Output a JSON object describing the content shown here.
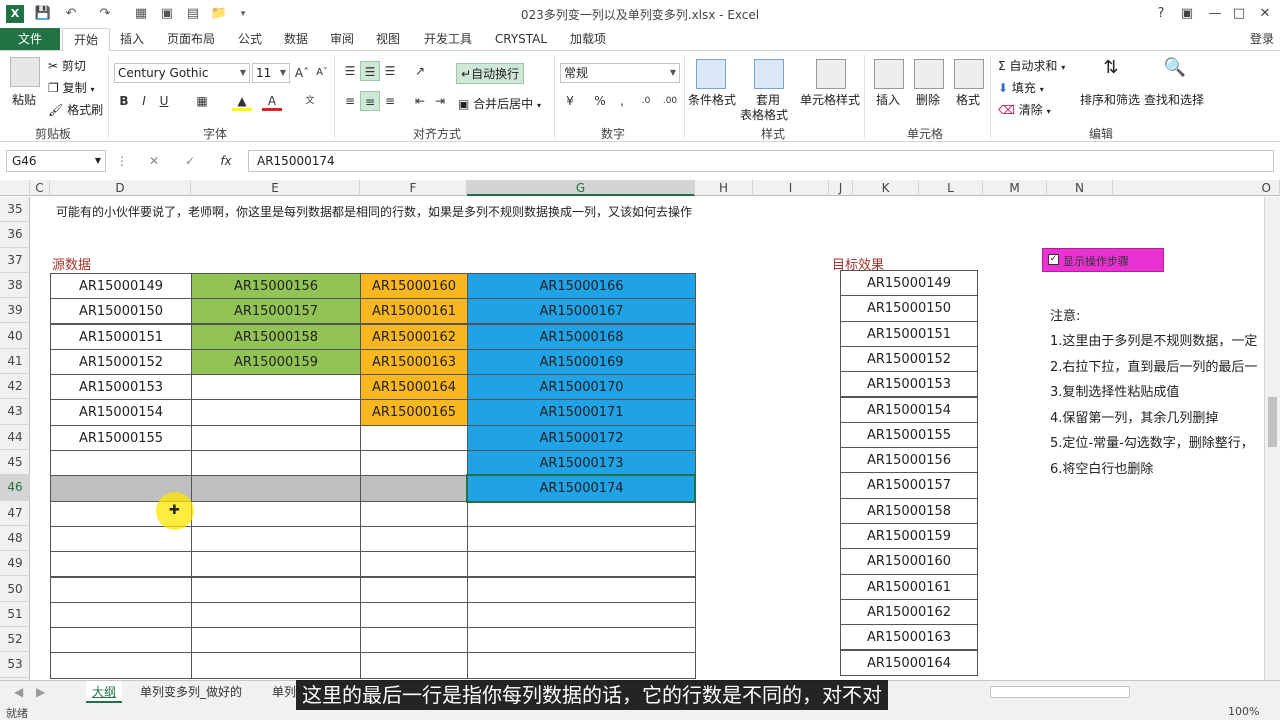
{
  "window": {
    "title": "023多列变一列以及单列变多列.xlsx - Excel",
    "help": "?",
    "signin": "登录"
  },
  "tabs": [
    "文件",
    "开始",
    "插入",
    "页面布局",
    "公式",
    "数据",
    "审阅",
    "视图",
    "开发工具",
    "CRYSTAL",
    "加载项"
  ],
  "ribbon": {
    "paste": "粘贴",
    "cut": "剪切",
    "copy": "复制",
    "format_painter": "格式刷",
    "clipboard_group": "剪贴板",
    "font_name": "Century Gothic",
    "font_size": "11",
    "font_group": "字体",
    "wrap_text": "自动换行",
    "merge_center": "合并后居中",
    "alignment_group": "对齐方式",
    "number_format": "常规",
    "number_group": "数字",
    "conditional_format": "条件格式",
    "table_format_1": "套用",
    "table_format_2": "表格格式",
    "cell_styles": "单元格样式",
    "styles_group": "样式",
    "insert": "插入",
    "delete": "删除",
    "format": "格式",
    "cells_group": "单元格",
    "autosum": "自动求和",
    "fill": "填充",
    "clear": "清除",
    "sort_filter": "排序和筛选",
    "find_select": "查找和选择",
    "editing_group": "编辑"
  },
  "formula_bar": {
    "name_box": "G46",
    "fx": "fx",
    "value": "AR15000174"
  },
  "columns": [
    "C",
    "D",
    "E",
    "F",
    "G",
    "H",
    "I",
    "J",
    "K",
    "L",
    "M",
    "N",
    "O"
  ],
  "rows": [
    "35",
    "36",
    "37",
    "38",
    "39",
    "40",
    "41",
    "42",
    "43",
    "44",
    "45",
    "46",
    "47",
    "48",
    "49",
    "50",
    "51",
    "52",
    "53"
  ],
  "sheet": {
    "note_row35": "可能有的小伙伴要说了，老师啊，你这里是每列数据都是相同的行数，如果是多列不规则数据换成一列，又该如何去操作",
    "source_label": "源数据",
    "target_label": "目标效果",
    "checkbox_label": "显示操作步骤",
    "col_d": [
      "AR15000149",
      "AR15000150",
      "AR15000151",
      "AR15000152",
      "AR15000153",
      "AR15000154",
      "AR15000155"
    ],
    "col_e": [
      "AR15000156",
      "AR15000157",
      "AR15000158",
      "AR15000159"
    ],
    "col_f": [
      "AR15000160",
      "AR15000161",
      "AR15000162",
      "AR15000163",
      "AR15000164",
      "AR15000165"
    ],
    "col_g": [
      "AR15000166",
      "AR15000167",
      "AR15000168",
      "AR15000169",
      "AR15000170",
      "AR15000171",
      "AR15000172",
      "AR15000173",
      "AR15000174"
    ],
    "target": [
      "AR15000149",
      "AR15000150",
      "AR15000151",
      "AR15000152",
      "AR15000153",
      "AR15000154",
      "AR15000155",
      "AR15000156",
      "AR15000157",
      "AR15000158",
      "AR15000159",
      "AR15000160",
      "AR15000161",
      "AR15000162",
      "AR15000163",
      "AR15000164"
    ],
    "notes_title": "注意:",
    "notes": [
      "1.这里由于多列是不规则数据，一定",
      "2.右拉下拉，直到最后一列的最后一",
      "3.复制选择性粘贴成值",
      "4.保留第一列，其余几列删掉",
      "5.定位-常量-勾选数字，删除整行，",
      "6.将空白行也删除"
    ]
  },
  "sheet_tabs": [
    "大纲",
    "单列变多列_做好的",
    "单列"
  ],
  "status": {
    "ready": "就绪",
    "zoom": "100%"
  },
  "subtitle": "这里的最后一行是指你每列数据的话，它的行数是不同的，对不对",
  "colors": {
    "excel_green": "#217346",
    "green_fill": "#92c455",
    "orange_fill": "#fbb71f",
    "blue_fill": "#1fa3e6",
    "magenta_checkbox": "#e832d2"
  }
}
